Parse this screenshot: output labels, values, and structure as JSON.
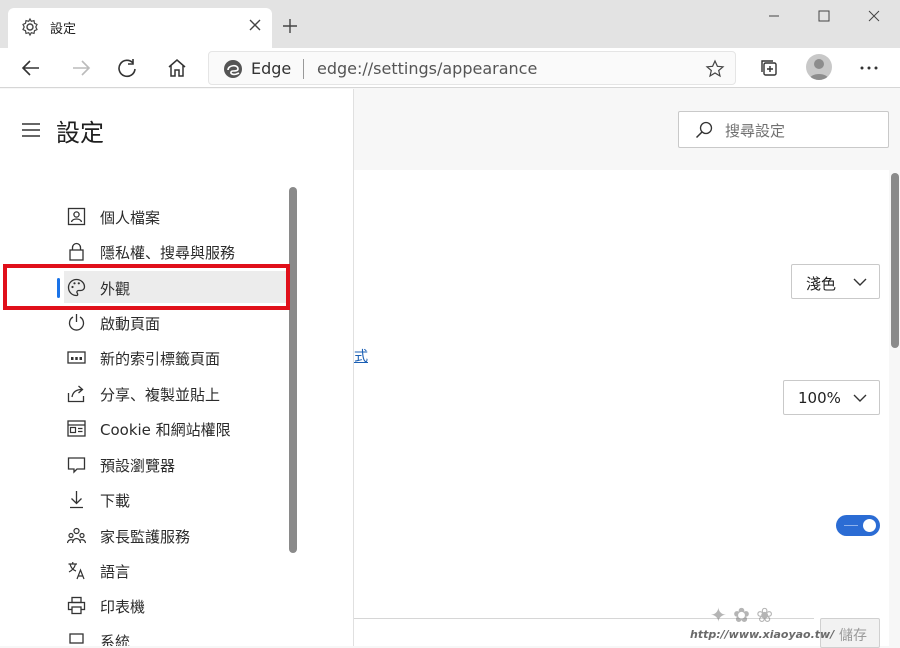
{
  "tab": {
    "title": "設定"
  },
  "address": {
    "brand": "Edge",
    "url": "edge://settings/appearance"
  },
  "sidebar": {
    "title": "設定",
    "items": [
      {
        "label": "個人檔案",
        "icon": "profile-icon"
      },
      {
        "label": "隱私權、搜尋與服務",
        "icon": "lock-icon"
      },
      {
        "label": "外觀",
        "icon": "palette-icon",
        "selected": true
      },
      {
        "label": "啟動頁面",
        "icon": "power-icon"
      },
      {
        "label": "新的索引標籤頁面",
        "icon": "newtab-page-icon"
      },
      {
        "label": "分享、複製並貼上",
        "icon": "share-icon"
      },
      {
        "label": "Cookie 和網站權限",
        "icon": "site-permissions-icon"
      },
      {
        "label": "預設瀏覽器",
        "icon": "default-browser-icon"
      },
      {
        "label": "下載",
        "icon": "download-icon"
      },
      {
        "label": "家長監護服務",
        "icon": "family-icon"
      },
      {
        "label": "語言",
        "icon": "language-icon"
      },
      {
        "label": "印表機",
        "icon": "printer-icon"
      },
      {
        "label": "系統",
        "icon": "system-icon"
      }
    ]
  },
  "search": {
    "placeholder": "搜尋設定"
  },
  "appearance": {
    "theme_value": "淺色",
    "zoom_value": "100%",
    "link_fragment": "式",
    "toggle_on": true,
    "save_label": "儲存"
  },
  "watermark": {
    "url": "http://www.xiaoyao.tw/"
  },
  "colors": {
    "accent": "#2b6cd4",
    "highlight": "#e0101a"
  }
}
